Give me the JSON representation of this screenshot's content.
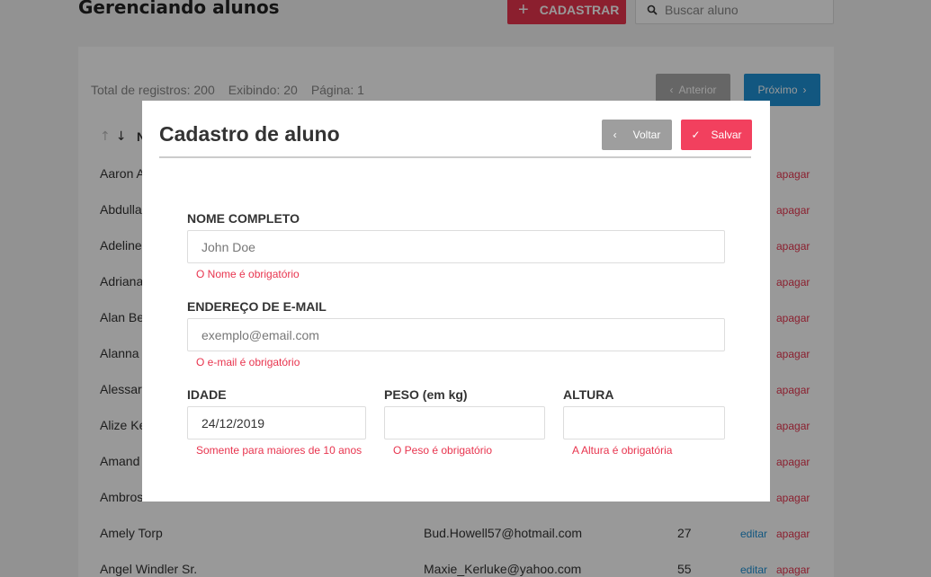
{
  "page": {
    "title": "Gerenciando alunos",
    "add_button": "CADASTRAR",
    "search_placeholder": "Buscar aluno"
  },
  "list": {
    "total": "Total de registros: 200",
    "showing": "Exibindo: 20",
    "page": "Página: 1",
    "prev": "Anterior",
    "next": "Próximo",
    "name_header_partial": "N",
    "edit_label": "editar",
    "delete_label": "apagar",
    "rows": [
      {
        "name": "Aaron A",
        "email": "",
        "age": ""
      },
      {
        "name": "Abdulla",
        "email": "",
        "age": ""
      },
      {
        "name": "Adeline",
        "email": "",
        "age": ""
      },
      {
        "name": "Adriana",
        "email": "",
        "age": ""
      },
      {
        "name": "Alan Be",
        "email": "",
        "age": ""
      },
      {
        "name": "Alanna",
        "email": "",
        "age": ""
      },
      {
        "name": "Alessar",
        "email": "",
        "age": ""
      },
      {
        "name": "Alize Ke",
        "email": "",
        "age": ""
      },
      {
        "name": "Amand",
        "email": "",
        "age": ""
      },
      {
        "name": "Ambros",
        "email": "",
        "age": ""
      },
      {
        "name": "Amely Torp",
        "email": "Bud.Howell57@hotmail.com",
        "age": "27"
      },
      {
        "name": "Angel Windler Sr.",
        "email": "Maxie_Kerluke@yahoo.com",
        "age": "55"
      }
    ]
  },
  "modal": {
    "title": "Cadastro de aluno",
    "back": "Voltar",
    "save": "Salvar",
    "name_label": "NOME COMPLETO",
    "name_placeholder": "John Doe",
    "name_error": "O Nome é obrigatório",
    "email_label": "ENDEREÇO DE E-MAIL",
    "email_placeholder": "exemplo@email.com",
    "email_error": "O e-mail é obrigatório",
    "age_label": "IDADE",
    "age_value": "24/12/2019",
    "age_error": "Somente para maiores de 10 anos",
    "weight_label": "PESO (em kg)",
    "weight_value": "",
    "weight_error": "O Peso é obrigatório",
    "height_label": "ALTURA",
    "height_value": "",
    "height_error": "A Altura é obrigatória"
  },
  "colors": {
    "accent": "#e8344e",
    "primary": "#1e91d6",
    "neutral_button": "#9e9e9e"
  }
}
